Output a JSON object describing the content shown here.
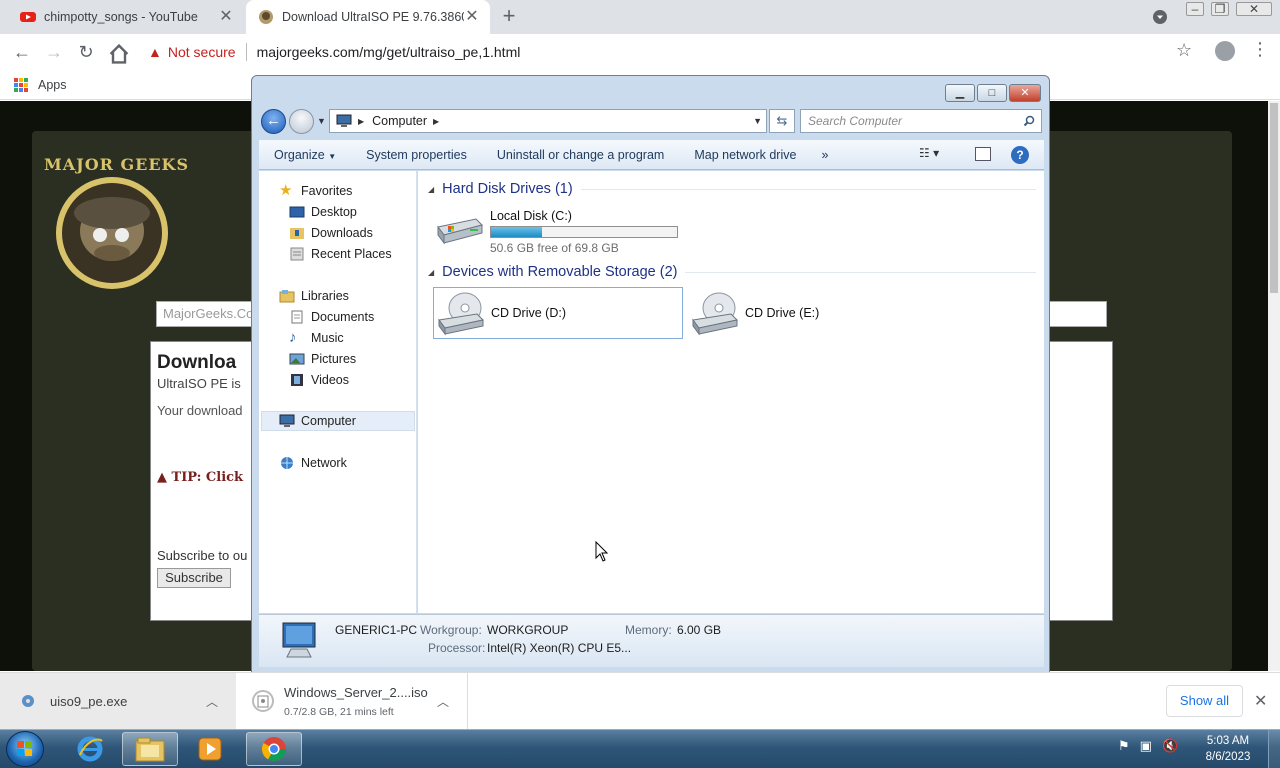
{
  "browser": {
    "tabs": [
      {
        "title": "chimpotty_songs - YouTube",
        "icon": "youtube-icon"
      },
      {
        "title": "Download UltraISO PE 9.76.3860",
        "icon": "majorgeeks-icon"
      }
    ],
    "security_label": "Not secure",
    "url": "majorgeeks.com/mg/get/ultraiso_pe,1.html",
    "bookmarks": [
      "Apps"
    ]
  },
  "webpage": {
    "logo_text": "MAJOR GEEKS",
    "search_text": "MajorGeeks.Co",
    "download_heading": "Downloa",
    "download_sub": "UltraISO PE is",
    "wait_text": "Your download",
    "tip_text": "TIP: Click",
    "subscribe_text": "Subscribe to ou",
    "subscribe_button": "Subscribe"
  },
  "explorer": {
    "address_crumb": "Computer",
    "search_placeholder": "Search Computer",
    "commands": [
      "Organize",
      "System properties",
      "Uninstall or change a program",
      "Map network drive"
    ],
    "commands_more": "»",
    "nav": {
      "favorites": "Favorites",
      "desktop": "Desktop",
      "downloads": "Downloads",
      "recent": "Recent Places",
      "libraries": "Libraries",
      "documents": "Documents",
      "music": "Music",
      "pictures": "Pictures",
      "videos": "Videos",
      "computer": "Computer",
      "network": "Network"
    },
    "groups": {
      "hdd": "Hard Disk Drives (1)",
      "removable": "Devices with Removable Storage (2)"
    },
    "drives": {
      "c_name": "Local Disk (C:)",
      "c_free": "50.6 GB free of 69.8 GB",
      "c_used_fraction": 0.275,
      "d_name": "CD Drive (D:)",
      "e_name": "CD Drive (E:)"
    },
    "details": {
      "pc_name": "GENERIC1-PC",
      "workgroup_label": "Workgroup:",
      "workgroup": "WORKGROUP",
      "memory_label": "Memory:",
      "memory": "6.00 GB",
      "processor_label": "Processor:",
      "processor": "Intel(R) Xeon(R) CPU E5..."
    }
  },
  "downloads": [
    {
      "name": "uiso9_pe.exe"
    },
    {
      "name": "Windows_Server_2....iso",
      "status": "0.7/2.8 GB, 21 mins left"
    }
  ],
  "show_all": "Show all",
  "clock": {
    "time": "5:03 AM",
    "date": "8/6/2023"
  },
  "colors": {
    "accent": "#1a73e8",
    "warning": "#c5221f",
    "explorer_frame": "#c9dbec",
    "drive_bar": "#1c8dc5"
  }
}
